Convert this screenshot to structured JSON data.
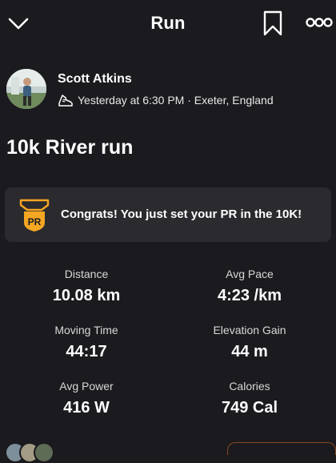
{
  "header": {
    "title": "Run",
    "back_icon": "chevron-down-icon",
    "bookmark_icon": "bookmark-icon",
    "more_icon": "more-options-icon"
  },
  "athlete": {
    "name": "Scott Atkins",
    "activity_icon": "shoe-icon",
    "date_location": "Yesterday at 6:30 PM · Exeter, England"
  },
  "activity": {
    "title": "10k River run"
  },
  "pr_banner": {
    "badge_text": "PR",
    "message": "Congrats! You just set your PR in the 10K!",
    "accent_color": "#f5a623"
  },
  "stats": [
    {
      "label": "Distance",
      "value": "10.08 km"
    },
    {
      "label": "Avg Pace",
      "value": "4:23 /km"
    },
    {
      "label": "Moving Time",
      "value": "44:17"
    },
    {
      "label": "Elevation Gain",
      "value": "44 m"
    },
    {
      "label": "Avg Power",
      "value": "416 W"
    },
    {
      "label": "Calories",
      "value": "749 Cal"
    }
  ],
  "colors": {
    "background": "#1b1a1e",
    "card": "#2b2a2f",
    "text": "#ffffff"
  }
}
